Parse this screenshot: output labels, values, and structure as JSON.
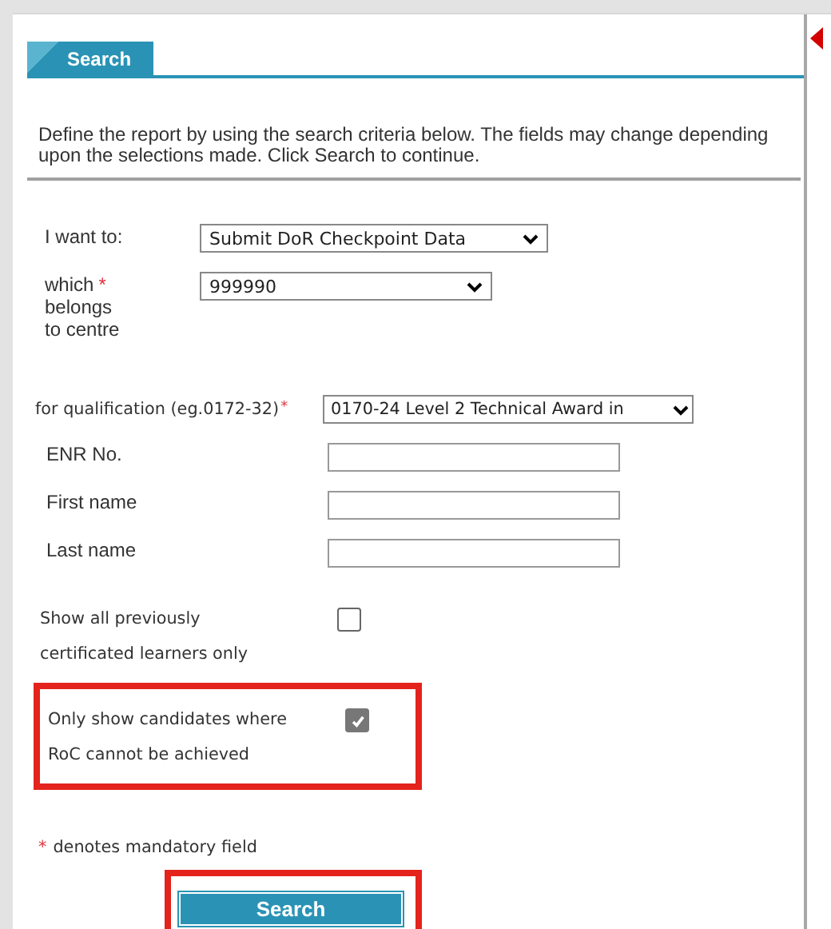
{
  "tab": {
    "label": "Search",
    "selected": true
  },
  "intro": "Define the report by using the search criteria below. The fields may change depending upon the selections made. Click Search to continue.",
  "selects": [
    {
      "label": "I want to:",
      "value": "Submit DoR Checkpoint Data"
    },
    {
      "label": "which",
      "required_mark": "*",
      "note": "belongs to centre",
      "value": "999990"
    }
  ],
  "qualification": {
    "label": "for qualification (eg.0172-32)",
    "required_mark": "*",
    "value": "0170-24 Level 2 Technical Award in"
  },
  "text_fields": [
    {
      "label": "ENR No."
    },
    {
      "label": "First name"
    },
    {
      "label": "Last name"
    }
  ],
  "checkboxes": [
    {
      "label": "Show all previously certificated learners only",
      "checked": false,
      "highlighted": false
    },
    {
      "label": "Only show candidates where RoC cannot be achieved",
      "checked": true,
      "highlighted": true
    }
  ],
  "footnote": {
    "mark": "*",
    "text": "denotes mandatory field"
  },
  "search_button": {
    "label": "Search",
    "highlighted": true
  }
}
